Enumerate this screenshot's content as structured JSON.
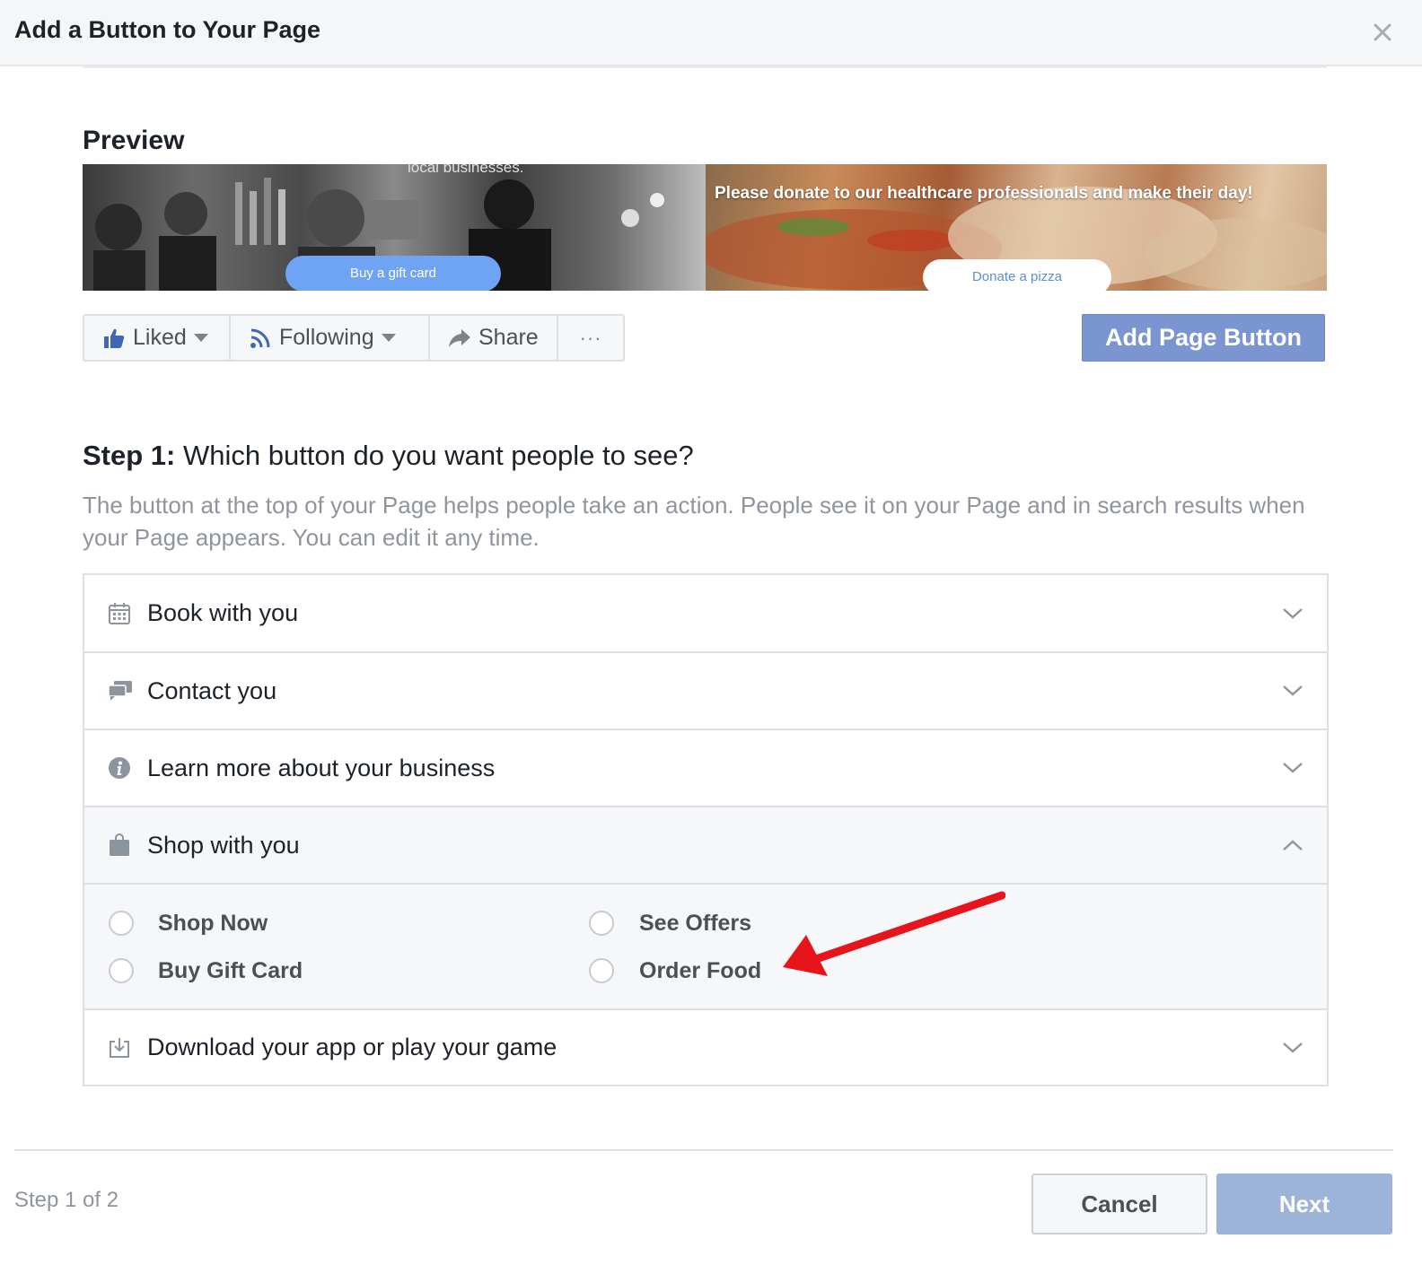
{
  "dialog": {
    "title": "Add a Button to Your Page",
    "close_icon": "close-icon"
  },
  "preview": {
    "title": "Preview",
    "cover": {
      "left_top_text": "local businesses.",
      "left_button": "Buy a gift card",
      "right_text": "Please donate to our healthcare professionals and make their day!",
      "right_button": "Donate a pizza"
    },
    "actions": [
      {
        "label": "Liked",
        "icon": "thumbs-up-icon"
      },
      {
        "label": "Following",
        "icon": "rss-icon"
      },
      {
        "label": "Share",
        "icon": "share-arrow-icon"
      },
      {
        "label": "···",
        "icon": "more-icon"
      }
    ],
    "add_button_label": "Add Page Button"
  },
  "step": {
    "title_bold": "Step 1:",
    "title_rest": " Which button do you want people to see?",
    "description": "The button at the top of your Page helps people take an action. People see it on your Page and in search results when your Page appears. You can edit it any time."
  },
  "categories": [
    {
      "label": "Book with you",
      "icon": "calendar-icon",
      "expanded": false
    },
    {
      "label": "Contact you",
      "icon": "chat-bubbles-icon",
      "expanded": false
    },
    {
      "label": "Learn more about your business",
      "icon": "info-icon",
      "expanded": false
    },
    {
      "label": "Shop with you",
      "icon": "shopping-bag-icon",
      "expanded": true
    },
    {
      "label": "Download your app or play your game",
      "icon": "download-icon",
      "expanded": false
    }
  ],
  "shop_options": [
    "Shop Now",
    "See Offers",
    "Buy Gift Card",
    "Order Food"
  ],
  "footer": {
    "step_text": "Step 1 of 2",
    "cancel_label": "Cancel",
    "next_label": "Next"
  },
  "colors": {
    "primary_button": "#7b95d1",
    "next_disabled": "#9cb4d8",
    "arrow": "#e8141b"
  }
}
